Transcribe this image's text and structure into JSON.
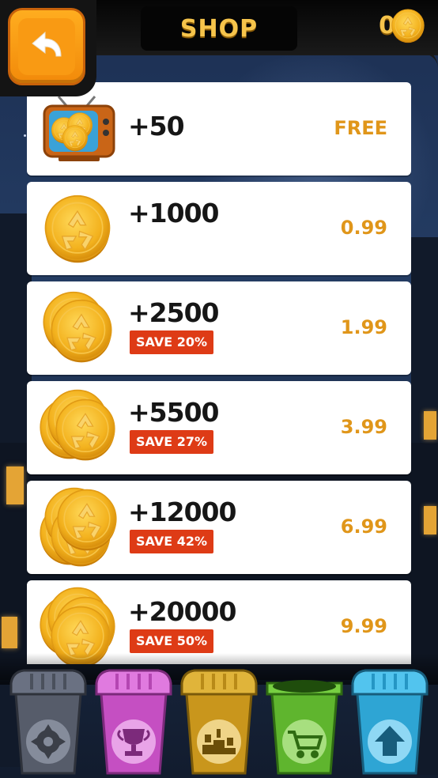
{
  "header": {
    "title": "SHOP",
    "coin_balance": "0"
  },
  "icons": {
    "back": "back-arrow-icon",
    "coin": "recycle-coin-icon",
    "tv": "tv-icon",
    "settings": "gear-icon",
    "trophy": "trophy-icon",
    "leaderboard": "podium-icon",
    "shop": "shopping-cart-icon",
    "upgrade": "up-arrow-icon"
  },
  "colors": {
    "accent": "#f6c44b",
    "price": "#e0961a",
    "badge": "#de3b16",
    "bin_gray": "#5b6170",
    "bin_pink": "#d96ad6",
    "bin_yellow": "#d9a92c",
    "bin_green": "#6ec43a",
    "bin_blue": "#3fb7e3"
  },
  "items": [
    {
      "amount": "+50",
      "price": "FREE",
      "badge": ""
    },
    {
      "amount": "+1000",
      "price": "0.99",
      "badge": ""
    },
    {
      "amount": "+2500",
      "price": "1.99",
      "badge": "SAVE 20%"
    },
    {
      "amount": "+5500",
      "price": "3.99",
      "badge": "SAVE 27%"
    },
    {
      "amount": "+12000",
      "price": "6.99",
      "badge": "SAVE 42%"
    },
    {
      "amount": "+20000",
      "price": "9.99",
      "badge": "SAVE 50%"
    }
  ],
  "nav": [
    {
      "icon": "gear-icon",
      "color": "gray"
    },
    {
      "icon": "trophy-icon",
      "color": "pink"
    },
    {
      "icon": "podium-icon",
      "color": "yellow"
    },
    {
      "icon": "shopping-cart-icon",
      "color": "green"
    },
    {
      "icon": "up-arrow-icon",
      "color": "blue"
    }
  ]
}
